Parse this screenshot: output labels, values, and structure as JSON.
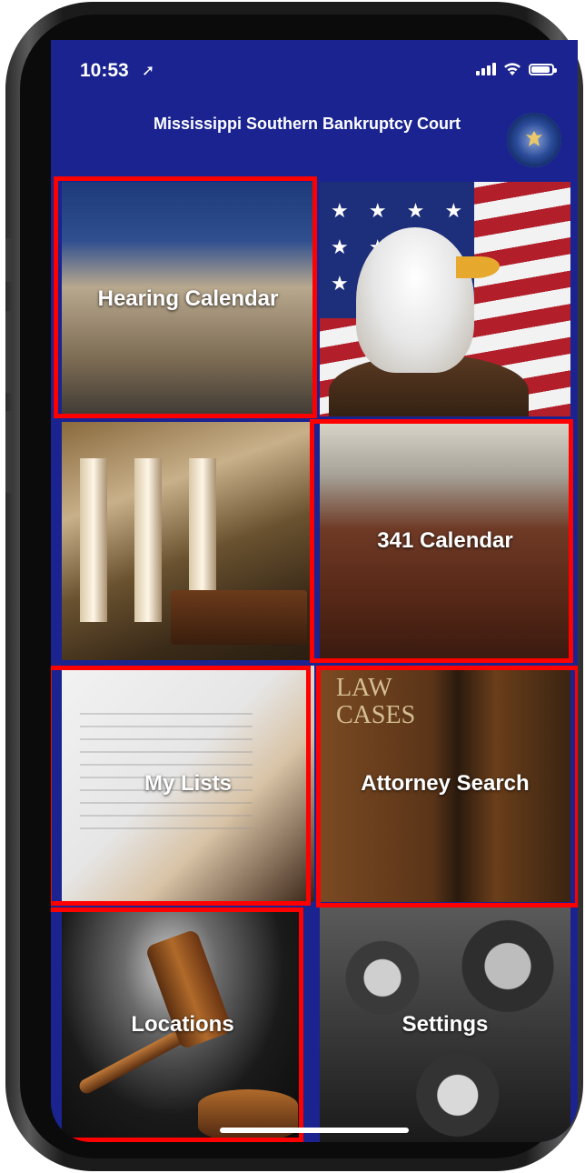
{
  "status_bar": {
    "time": "10:53",
    "location_icon": "location-arrow-icon",
    "signal_icon": "cellular-signal-icon",
    "wifi_icon": "wifi-icon",
    "battery_icon": "battery-icon"
  },
  "header": {
    "title": "Mississippi Southern Bankruptcy Court",
    "seal_icon": "court-seal-icon"
  },
  "tiles": {
    "hearing_calendar": {
      "label": "Hearing Calendar",
      "image": "courthouse-columns"
    },
    "flag_eagle": {
      "label": "",
      "image": "bald-eagle-american-flag"
    },
    "scales": {
      "label": "",
      "image": "scales-of-justice-columns"
    },
    "calendar_341": {
      "label": "341 Calendar",
      "image": "courtroom-interior"
    },
    "my_lists": {
      "label": "My Lists",
      "image": "signing-document"
    },
    "attorney_search": {
      "label": "Attorney Search",
      "image": "law-case-books",
      "book_text": "LAW\nCASES"
    },
    "locations": {
      "label": "Locations",
      "image": "judge-gavel"
    },
    "settings": {
      "label": "Settings",
      "image": "metal-gears"
    }
  },
  "colors": {
    "app_blue": "#1a2390",
    "highlight": "#ff0000"
  }
}
